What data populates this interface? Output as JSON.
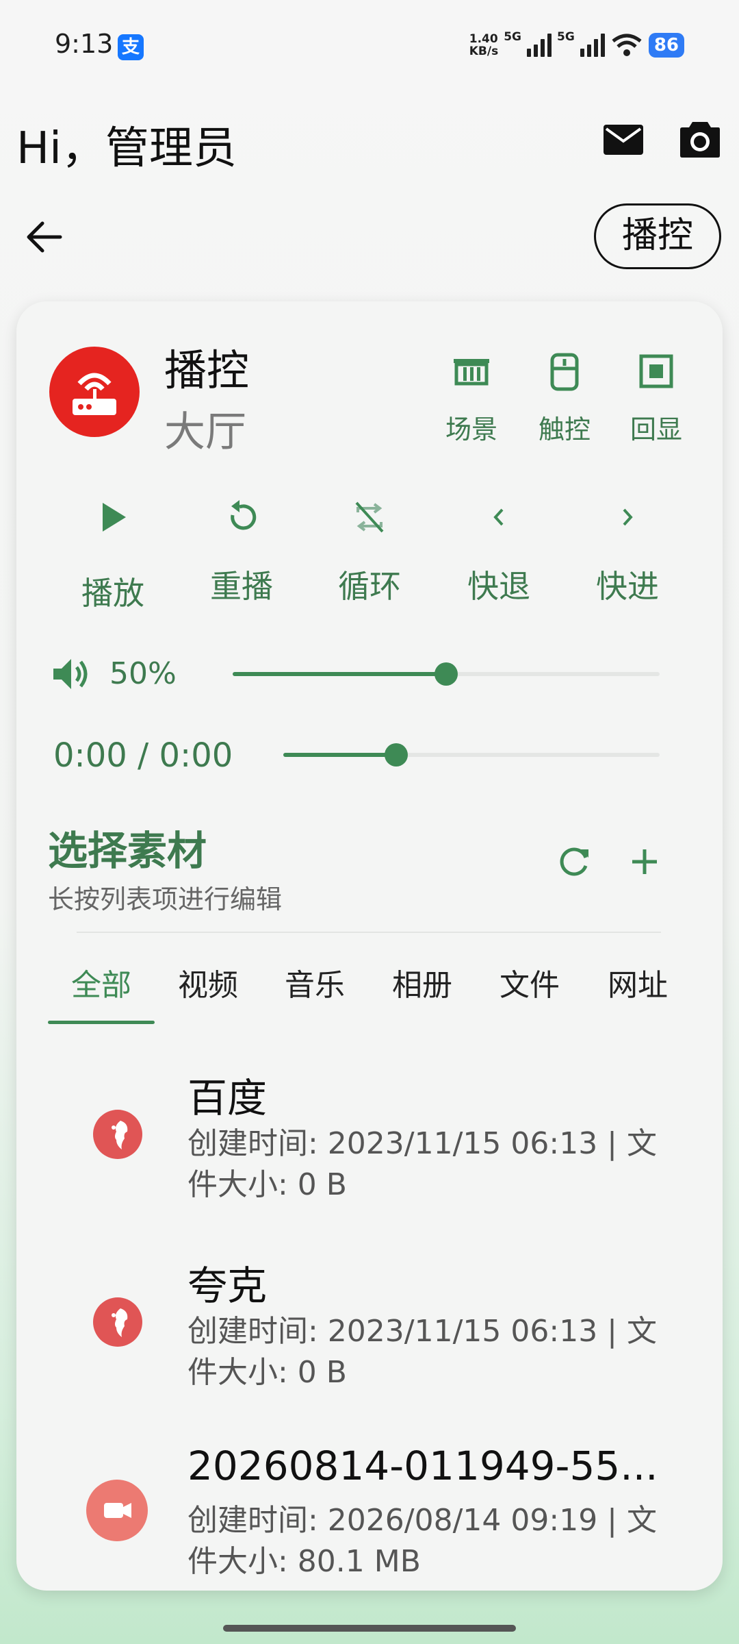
{
  "status_bar": {
    "time": "9:13",
    "alipay_glyph": "支",
    "net_speed_value": "1.40",
    "net_speed_unit": "KB/s",
    "sim1_tag": "5G",
    "sim2_tag": "5G",
    "battery": "86"
  },
  "header": {
    "greeting": "Hi，管理员"
  },
  "toolbar": {
    "mode_pill": "播控"
  },
  "device": {
    "title": "播控",
    "subtitle": "大厅",
    "quick_actions": [
      {
        "label": "场景",
        "icon": "scene-icon"
      },
      {
        "label": "触控",
        "icon": "touch-icon"
      },
      {
        "label": "回显",
        "icon": "mirror-icon"
      }
    ]
  },
  "controls": [
    {
      "label": "播放",
      "icon": "play-icon"
    },
    {
      "label": "重播",
      "icon": "replay-icon"
    },
    {
      "label": "循环",
      "icon": "loop-off-icon"
    },
    {
      "label": "快退",
      "icon": "rewind-icon"
    },
    {
      "label": "快进",
      "icon": "forward-icon"
    }
  ],
  "volume": {
    "label": "50%",
    "level": 0.5
  },
  "progress": {
    "label": "0:00 / 0:00",
    "level": 0.3
  },
  "materials": {
    "title": "选择素材",
    "subtitle": "长按列表项进行编辑",
    "tabs": [
      "全部",
      "视频",
      "音乐",
      "相册",
      "文件",
      "网址"
    ],
    "active_tab": 0,
    "items": [
      {
        "title": "百度",
        "desc": "创建时间: 2023/11/15 06:13 | 文件大小: 0 B",
        "icon": "web-globe-icon"
      },
      {
        "title": "夸克",
        "desc": "创建时间: 2023/11/15 06:13 | 文件大小: 0 B",
        "icon": "web-globe-icon"
      },
      {
        "title": "20260814-011949-55...",
        "desc": "创建时间: 2026/08/14 09:19 | 文件大小: 80.1 MB",
        "icon": "video-icon"
      }
    ]
  },
  "colors": {
    "accent_green": "#3e8a55",
    "device_red": "#e52420",
    "item_red": "#e05555",
    "item_pink": "#ec7a72"
  }
}
